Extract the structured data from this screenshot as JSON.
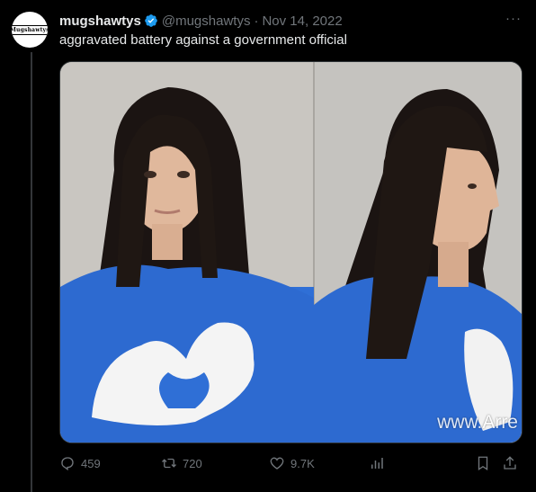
{
  "tweet": {
    "display_name": "mugshawtys",
    "handle": "@mugshawtys",
    "separator": "·",
    "date": "Nov 14, 2022",
    "text": "aggravated battery against a government official",
    "avatar_logo_text": "Mugshawtys",
    "more_glyph": "···"
  },
  "media": {
    "watermark": "www.Arre"
  },
  "actions": {
    "replies": "459",
    "retweets": "720",
    "likes": "9.7K"
  },
  "colors": {
    "background": "#000000",
    "text": "#e7e9ea",
    "muted": "#71767b",
    "verified": "#1d9bf0",
    "hoodie": "#2f6fd6"
  }
}
